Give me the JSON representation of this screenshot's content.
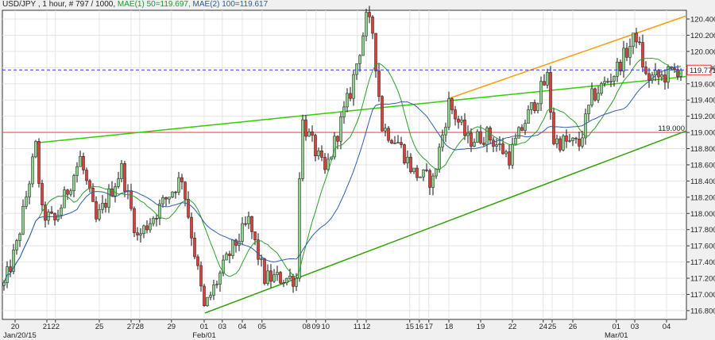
{
  "header": {
    "symbol_info": "USD/JPY , 1 hour, # 797 / 1000,",
    "ma1": "MAE(1) 50=119.697,",
    "ma2": "MAE(2) 100=119.617"
  },
  "colors": {
    "up": "#8fd18f",
    "down": "#e23b3b",
    "ma1": "#2aa02a",
    "ma2": "#2f5ea8",
    "trend": "#33cc00",
    "orange": "#ff9900",
    "support": "#ff4d4d",
    "current": "#3333ff"
  },
  "chart_data": {
    "type": "candlestick",
    "title": "USD/JPY , 1 hour",
    "ylim": [
      116.7,
      120.52
    ],
    "bars": 214,
    "y_ticks": [
      "120.400",
      "120.200",
      "120.000",
      "119.800",
      "119.600",
      "119.400",
      "119.200",
      "119.000",
      "118.800",
      "118.600",
      "118.400",
      "118.200",
      "118.000",
      "117.800",
      "117.600",
      "117.400",
      "117.200",
      "117.000",
      "116.800"
    ],
    "x_ticks": [
      {
        "bar": 3.5,
        "label": "20"
      },
      {
        "bar": 13.5,
        "label": "21"
      },
      {
        "bar": 16.2,
        "label": "22"
      },
      {
        "bar": 30,
        "label": "25"
      },
      {
        "bar": 40,
        "label": "27"
      },
      {
        "bar": 42.7,
        "label": "28"
      },
      {
        "bar": 52.7,
        "label": "29"
      },
      {
        "bar": 63,
        "label": "01"
      },
      {
        "bar": 68.7,
        "label": "03"
      },
      {
        "bar": 75,
        "label": "04"
      },
      {
        "bar": 81.2,
        "label": "05"
      },
      {
        "bar": 95.2,
        "label": "08"
      },
      {
        "bar": 98.2,
        "label": "09"
      },
      {
        "bar": 101.2,
        "label": "10"
      },
      {
        "bar": 111.2,
        "label": "11"
      },
      {
        "bar": 114,
        "label": "12"
      },
      {
        "bar": 127.7,
        "label": "15"
      },
      {
        "bar": 130.7,
        "label": "16"
      },
      {
        "bar": 133.7,
        "label": "17"
      },
      {
        "bar": 140,
        "label": "18"
      },
      {
        "bar": 150,
        "label": "19"
      },
      {
        "bar": 160,
        "label": "22"
      },
      {
        "bar": 169.7,
        "label": "24"
      },
      {
        "bar": 172.5,
        "label": "25"
      },
      {
        "bar": 179,
        "label": "26"
      },
      {
        "bar": 192.7,
        "label": "01"
      },
      {
        "bar": 198.5,
        "label": "03"
      },
      {
        "bar": 208.5,
        "label": "04"
      }
    ],
    "month_labels": [
      {
        "bar": 3.5,
        "label": "Jan/20/15"
      },
      {
        "bar": 63,
        "label": "Feb/01"
      },
      {
        "bar": 192.7,
        "label": "Mar/01"
      }
    ],
    "close_path": [
      [
        0,
        117.11
      ],
      [
        4,
        117.6
      ],
      [
        10,
        118.82
      ],
      [
        12,
        118.0
      ],
      [
        16,
        117.9
      ],
      [
        24,
        118.68
      ],
      [
        29,
        117.9
      ],
      [
        37,
        118.55
      ],
      [
        42,
        117.7
      ],
      [
        56,
        118.45
      ],
      [
        63,
        116.82
      ],
      [
        71,
        117.5
      ],
      [
        77,
        117.9
      ],
      [
        82,
        117.2
      ],
      [
        92,
        117.2
      ],
      [
        93.5,
        119.17
      ],
      [
        101,
        118.5
      ],
      [
        109,
        119.5
      ],
      [
        114,
        120.39
      ],
      [
        116,
        120.25
      ],
      [
        119,
        119.07
      ],
      [
        124,
        118.88
      ],
      [
        129,
        118.5
      ],
      [
        135,
        118.4
      ],
      [
        140,
        119.36
      ],
      [
        146,
        118.9
      ],
      [
        152,
        118.97
      ],
      [
        159,
        118.7
      ],
      [
        164,
        119.14
      ],
      [
        171,
        119.68
      ],
      [
        173,
        118.9
      ],
      [
        181,
        118.85
      ],
      [
        185,
        119.43
      ],
      [
        192,
        119.73
      ],
      [
        199,
        120.2
      ],
      [
        202,
        119.68
      ],
      [
        207,
        119.68
      ],
      [
        213,
        119.8
      ]
    ],
    "moving_averages": [
      {
        "name": "MAE(1) 50",
        "value": 119.697
      },
      {
        "name": "MAE(2) 100",
        "value": 119.617
      }
    ],
    "trendlines": [
      {
        "name": "upper-trendline",
        "from": [
          10,
          118.87
        ],
        "to": [
          214.75,
          119.69
        ]
      },
      {
        "name": "lower-trendline",
        "from": [
          63.25,
          116.77
        ],
        "to": [
          214.75,
          119.02
        ]
      },
      {
        "name": "orange-channel",
        "from": [
          140,
          119.42
        ],
        "to": [
          214.75,
          120.44
        ]
      }
    ],
    "support_level": {
      "value": 119.0,
      "label": "119.000"
    },
    "current_price": {
      "value": 119.771,
      "label": "119.771"
    }
  }
}
